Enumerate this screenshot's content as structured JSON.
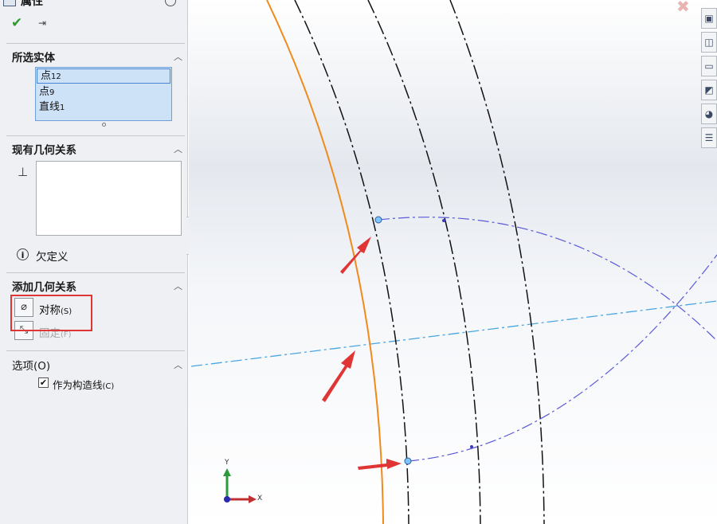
{
  "panel": {
    "title": "属性",
    "header_icon": "property-manager-icon",
    "ok_glyph": "✔",
    "pin_glyph": "⇥",
    "collapse_glyph": "︿",
    "selected_entities": {
      "title": "所选实体",
      "items": [
        {
          "name": "点",
          "num": "12"
        },
        {
          "name": "点",
          "num": "9"
        },
        {
          "name": "直线",
          "num": "1"
        }
      ]
    },
    "existing_relations": {
      "title": "现有几何关系",
      "icon_glyph": "⊥",
      "status_icon": "i",
      "status": "欠定义"
    },
    "add_relations": {
      "title": "添加几何关系",
      "symmetric": {
        "label": "对称",
        "key": "(S)",
        "icon_glyph": "⌀"
      },
      "fix": {
        "label": "固定",
        "key": "(F)",
        "icon_glyph": "⤡"
      }
    },
    "options": {
      "title": "选项(O)",
      "construction": {
        "label": "作为构造线",
        "key": "(C)",
        "checked": true,
        "check_glyph": "✔"
      }
    }
  },
  "toolbar": {
    "close_glyph": "✖",
    "buttons": [
      {
        "name": "view-orientation-icon",
        "glyph": "▣"
      },
      {
        "name": "cube-icon",
        "glyph": "◫"
      },
      {
        "name": "folder-icon",
        "glyph": "▭"
      },
      {
        "name": "appearance-icon",
        "glyph": "◩"
      },
      {
        "name": "color-wheel-icon",
        "glyph": "◕"
      },
      {
        "name": "list-icon",
        "glyph": "☰"
      }
    ]
  },
  "axes": {
    "x": "X",
    "y": "Y"
  },
  "colors": {
    "accent_orange": "#f08a1c",
    "sketch_black": "#111111",
    "construction_blue": "#5a5ad8",
    "centerline_cyan": "#4aa6e0",
    "annotation_red": "#e03535",
    "selection_fill": "#cde2f7"
  }
}
